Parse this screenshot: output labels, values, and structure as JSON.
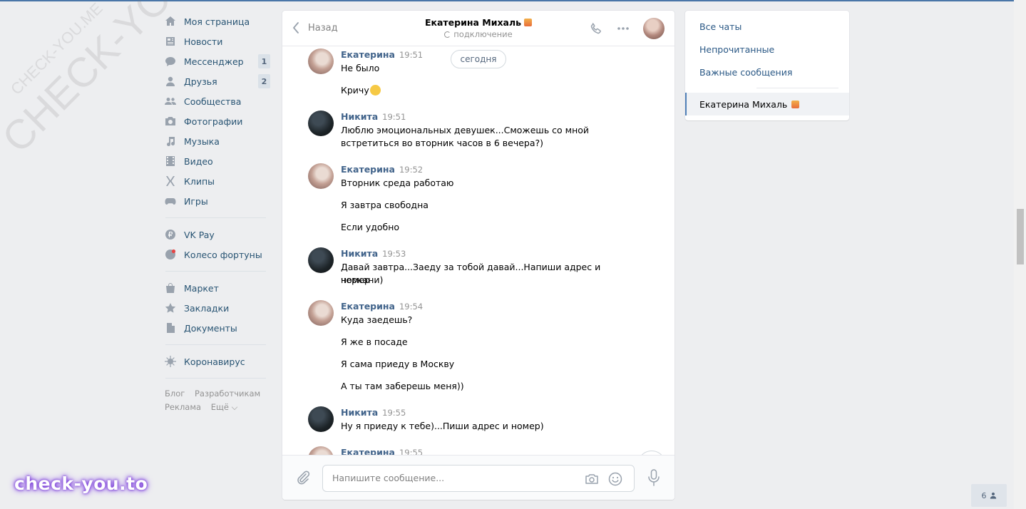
{
  "watermark": {
    "big": "CHECK-YOU.ME",
    "small": "CHECK-YOU.ME",
    "brand": "check-you.to"
  },
  "sidebar": {
    "items": [
      {
        "label": "Моя страница",
        "icon": "home-icon"
      },
      {
        "label": "Новости",
        "icon": "news-icon"
      },
      {
        "label": "Мессенджер",
        "icon": "messenger-icon",
        "badge": "1"
      },
      {
        "label": "Друзья",
        "icon": "friends-icon",
        "badge": "2"
      },
      {
        "label": "Сообщества",
        "icon": "groups-icon"
      },
      {
        "label": "Фотографии",
        "icon": "camera-icon"
      },
      {
        "label": "Музыка",
        "icon": "music-icon"
      },
      {
        "label": "Видео",
        "icon": "video-icon"
      },
      {
        "label": "Клипы",
        "icon": "clips-icon"
      },
      {
        "label": "Игры",
        "icon": "gamepad-icon"
      },
      {
        "label": "VK Pay",
        "icon": "vkpay-icon"
      },
      {
        "label": "Колесо фортуны",
        "icon": "fortune-icon"
      },
      {
        "label": "Маркет",
        "icon": "market-icon"
      },
      {
        "label": "Закладки",
        "icon": "star-icon"
      },
      {
        "label": "Документы",
        "icon": "document-icon"
      },
      {
        "label": "Коронавирус",
        "icon": "virus-icon"
      }
    ],
    "footer": {
      "blog": "Блог",
      "developers": "Разработчикам",
      "ads": "Реклама",
      "more": "Ещё ⌵"
    }
  },
  "chat": {
    "back_label": "Назад",
    "peer_name": "Екатерина Михаль",
    "peer_status": "подключение",
    "date_pill": "сегодня",
    "messages": [
      {
        "author": "Екатерина",
        "time": "19:51",
        "lines": [
          "Не было",
          "Кричу"
        ]
      },
      {
        "author": "Никита",
        "time": "19:51",
        "lines": [
          "Люблю эмоциональных девушек...Сможешь со мной",
          "встретиться во вторник часов в 6 вечера?)"
        ]
      },
      {
        "author": "Екатерина",
        "time": "19:52",
        "lines": [
          "Вторник среда работаю",
          "Я завтра свободна",
          "Если удобно"
        ]
      },
      {
        "author": "Никита",
        "time": "19:53",
        "lines": [
          "Давай завтра...Заеду за тобой давай...Напиши адрес и номер",
          "черкани)"
        ]
      },
      {
        "author": "Екатерина",
        "time": "19:54",
        "lines": [
          "Куда заедешь?",
          "Я же в посаде",
          "Я сама приеду в Москву",
          "А ты там заберешь меня))"
        ]
      },
      {
        "author": "Никита",
        "time": "19:55",
        "lines": [
          "Ну я приеду к тебе)...Пиши адрес и номер)"
        ]
      },
      {
        "author": "Екатерина",
        "time": "19:55",
        "lines": []
      }
    ],
    "input_placeholder": "Напишите сообщение..."
  },
  "right_panel": {
    "all_chats": "Все чаты",
    "unread": "Непрочитанные",
    "important": "Важные сообщения",
    "active_chat": "Екатерина Михаль"
  },
  "online_count": "6",
  "colors": {
    "accent": "#4a76a8",
    "link": "#2a5885",
    "author": "#42648b",
    "background": "#edeef0"
  }
}
